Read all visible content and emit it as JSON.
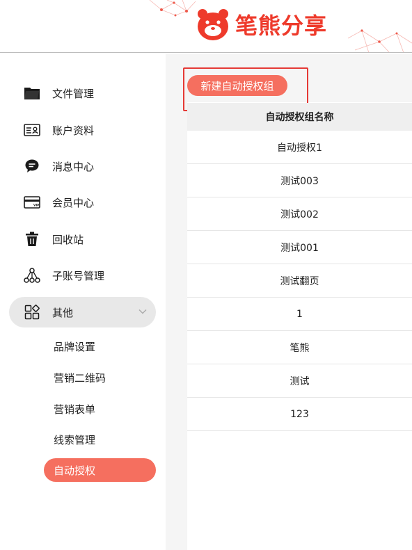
{
  "brand": {
    "name": "笔熊分享",
    "color": "#ee3a2b",
    "logo_icon": "bear-logo-icon"
  },
  "accent_color": "#f56f5f",
  "sidebar": {
    "items": [
      {
        "label": "文件管理",
        "icon": "folder-icon"
      },
      {
        "label": "账户资料",
        "icon": "id-card-icon"
      },
      {
        "label": "消息中心",
        "icon": "chat-bubble-icon"
      },
      {
        "label": "会员中心",
        "icon": "vip-card-icon"
      },
      {
        "label": "回收站",
        "icon": "trash-icon"
      },
      {
        "label": "子账号管理",
        "icon": "org-tree-icon"
      },
      {
        "label": "其他",
        "icon": "apps-icon",
        "expanded": true
      }
    ],
    "sub_items": [
      {
        "label": "品牌设置"
      },
      {
        "label": "营销二维码"
      },
      {
        "label": "营销表单"
      },
      {
        "label": "线索管理"
      },
      {
        "label": "自动授权",
        "active": true
      }
    ]
  },
  "main": {
    "new_button": "新建自动授权组",
    "table": {
      "header": "自动授权组名称",
      "rows": [
        "自动授权1",
        "测试003",
        "测试002",
        "测试001",
        "测试翻页",
        "1",
        "笔熊",
        "测试",
        "123"
      ]
    }
  }
}
